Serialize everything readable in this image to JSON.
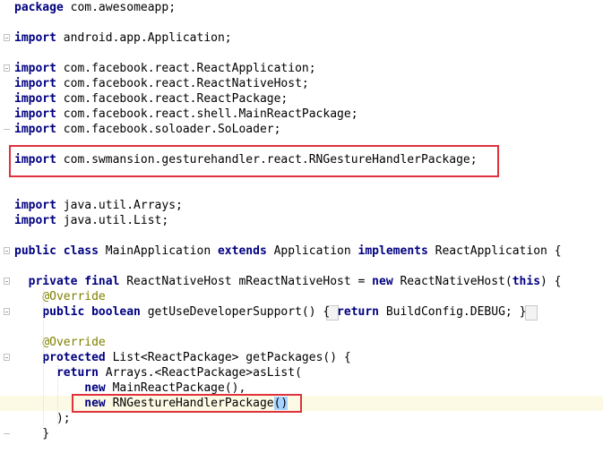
{
  "editor": {
    "language": "java",
    "lines": [
      [
        {
          "k": "kw",
          "t": "package"
        },
        {
          "t": " com.awesomeapp;"
        }
      ],
      [],
      [
        {
          "k": "kw",
          "t": "import"
        },
        {
          "t": " android.app.Application;"
        }
      ],
      [],
      [
        {
          "k": "kw",
          "t": "import"
        },
        {
          "t": " com.facebook.react.ReactApplication;"
        }
      ],
      [
        {
          "k": "kw",
          "t": "import"
        },
        {
          "t": " com.facebook.react.ReactNativeHost;"
        }
      ],
      [
        {
          "k": "kw",
          "t": "import"
        },
        {
          "t": " com.facebook.react.ReactPackage;"
        }
      ],
      [
        {
          "k": "kw",
          "t": "import"
        },
        {
          "t": " com.facebook.react.shell.MainReactPackage;"
        }
      ],
      [
        {
          "k": "kw",
          "t": "import"
        },
        {
          "t": " com.facebook.soloader.SoLoader;"
        }
      ],
      [],
      [
        {
          "k": "kw",
          "t": "import"
        },
        {
          "t": " com.swmansion.gesturehandler.react.RNGestureHandlerPackage;"
        }
      ],
      [],
      [],
      [
        {
          "k": "kw",
          "t": "import"
        },
        {
          "t": " java.util.Arrays;"
        }
      ],
      [
        {
          "k": "kw",
          "t": "import"
        },
        {
          "t": " java.util.List;"
        }
      ],
      [],
      [
        {
          "k": "kw",
          "t": "public class"
        },
        {
          "t": " MainApplication "
        },
        {
          "k": "kw",
          "t": "extends"
        },
        {
          "t": " Application "
        },
        {
          "k": "kw",
          "t": "implements"
        },
        {
          "t": " ReactApplication {"
        }
      ],
      [],
      [
        {
          "t": "  "
        },
        {
          "k": "kw",
          "t": "private final"
        },
        {
          "t": " ReactNativeHost mReactNativeHost = "
        },
        {
          "k": "kw",
          "t": "new"
        },
        {
          "t": " ReactNativeHost("
        },
        {
          "k": "kw",
          "t": "this"
        },
        {
          "t": ") {"
        }
      ],
      [
        {
          "t": "    "
        },
        {
          "k": "an",
          "t": "@Override"
        }
      ],
      [
        {
          "t": "    "
        },
        {
          "k": "kw",
          "t": "public boolean"
        },
        {
          "t": " getUseDeveloperSupport() "
        },
        {
          "k": "br",
          "t": "{"
        },
        {
          "t": " "
        },
        {
          "k": "kw",
          "t": "return"
        },
        {
          "t": " BuildConfig.DEBUG; "
        },
        {
          "k": "br",
          "t": "}"
        }
      ],
      [],
      [
        {
          "t": "    "
        },
        {
          "k": "an",
          "t": "@Override"
        }
      ],
      [
        {
          "t": "    "
        },
        {
          "k": "kw",
          "t": "protected"
        },
        {
          "t": " List<ReactPackage> getPackages() {"
        }
      ],
      [
        {
          "t": "      "
        },
        {
          "k": "kw",
          "t": "return"
        },
        {
          "t": " Arrays.<ReactPackage>asList("
        }
      ],
      [
        {
          "t": "          "
        },
        {
          "k": "kw",
          "t": "new"
        },
        {
          "t": " MainReactPackage(),"
        }
      ],
      [
        {
          "t": "          "
        },
        {
          "k": "kw",
          "t": "new"
        },
        {
          "t": " RNGestureHandlerPackage"
        },
        {
          "k": "pm",
          "t": "()"
        }
      ],
      [
        {
          "t": "      );"
        }
      ],
      [
        {
          "t": "    }"
        }
      ]
    ]
  }
}
